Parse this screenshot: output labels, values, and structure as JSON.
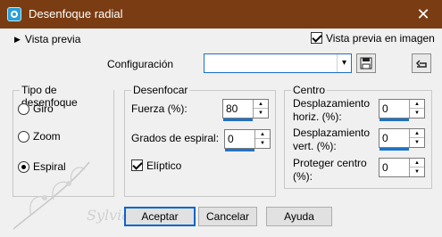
{
  "window": {
    "title": "Desenfoque radial",
    "close_icon": "close-icon"
  },
  "preview": {
    "toggle_label": "Vista previa",
    "show_in_image_label": "Vista previa en imagen",
    "show_in_image_checked": true
  },
  "configuration": {
    "label": "Configuración",
    "value": "",
    "save_icon": "save-icon",
    "reset_icon": "reset-icon"
  },
  "blur_type": {
    "title": "Tipo de desenfoque",
    "options": [
      {
        "label": "Giro",
        "selected": false
      },
      {
        "label": "Zoom",
        "selected": false
      },
      {
        "label": "Espiral",
        "selected": true
      }
    ]
  },
  "blur": {
    "title": "Desenfocar",
    "strength_label": "Fuerza (%):",
    "strength_value": "80",
    "spiral_degrees_label": "Grados de espiral:",
    "spiral_degrees_value": "0",
    "elliptical_label": "Elíptico",
    "elliptical_checked": true
  },
  "center": {
    "title": "Centro",
    "horiz_label": "Desplazamiento horiz. (%):",
    "horiz_value": "0",
    "vert_label": "Desplazamiento vert. (%):",
    "vert_value": "0",
    "protect_label": "Proteger centro (%):",
    "protect_value": "0"
  },
  "buttons": {
    "ok": "Aceptar",
    "cancel": "Cancelar",
    "help": "Ayuda"
  },
  "watermark": {
    "text": "Sylviane"
  },
  "colors": {
    "titlebar": "#7a3c12",
    "accent": "#1e73c9",
    "background": "#f0f0f0"
  }
}
